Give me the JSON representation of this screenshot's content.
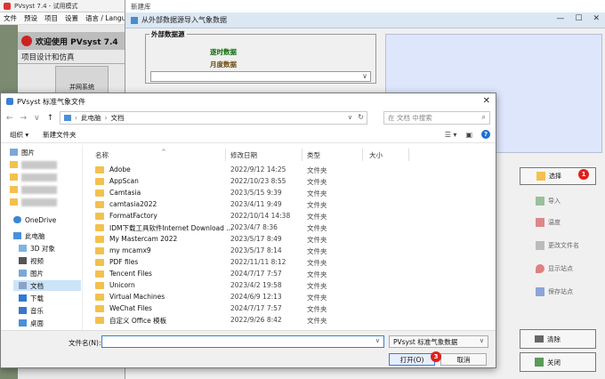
{
  "pvsyst": {
    "title": "PVsyst 7.4 - 试用模式",
    "menu": [
      "文件",
      "预设",
      "项目",
      "设置",
      "语言 / Langu"
    ],
    "welcome": "欢迎使用 PVsyst 7.4",
    "section": "项目设计和仿真",
    "tile": "并网系统"
  },
  "import_dialog": {
    "parent_title": "新建库",
    "title": "从外部数据源导入气象数据",
    "group_label": "外部数据源",
    "realtime": "逐时数据",
    "monthly": "月度数据",
    "buttons": [
      {
        "label": "选择",
        "icon": "folder-open-icon",
        "active": true
      },
      {
        "label": "导入",
        "icon": "import-icon",
        "active": false
      },
      {
        "label": "温度",
        "icon": "thermometer-icon",
        "active": false
      },
      {
        "label": "更改文件名",
        "icon": "rename-icon",
        "active": false
      },
      {
        "label": "显示站点",
        "icon": "location-pin-icon",
        "active": false
      },
      {
        "label": "保存站点",
        "icon": "save-icon",
        "active": false
      }
    ],
    "clear_label": "清除",
    "close_label": "关闭"
  },
  "badges": [
    "1",
    "2",
    "3"
  ],
  "file_dialog": {
    "title": "PVsyst 标准气象文件",
    "breadcrumb": [
      "此电脑",
      "文档"
    ],
    "search_placeholder": "在 文档 中搜索",
    "organize": "组织 ▾",
    "new_folder": "新建文件夹",
    "tree": [
      {
        "label": "图片",
        "icon": "pictures-icon",
        "blurred": false
      },
      {
        "label": "",
        "icon": "folder-icon",
        "blurred": true
      },
      {
        "label": "",
        "icon": "folder-icon",
        "blurred": true
      },
      {
        "label": "",
        "icon": "folder-icon",
        "blurred": true
      },
      {
        "label": "",
        "icon": "folder-icon",
        "blurred": true
      },
      {
        "label": "OneDrive",
        "icon": "cloud-icon",
        "blurred": false
      },
      {
        "label": "此电脑",
        "icon": "pc-icon",
        "blurred": false
      },
      {
        "label": "3D 对象",
        "icon": "cube-icon",
        "blurred": false
      },
      {
        "label": "视频",
        "icon": "video-icon",
        "blurred": false
      },
      {
        "label": "图片",
        "icon": "pictures-icon",
        "blurred": false
      },
      {
        "label": "文档",
        "icon": "documents-icon",
        "blurred": false,
        "selected": true
      },
      {
        "label": "下载",
        "icon": "download-icon",
        "blurred": false
      },
      {
        "label": "音乐",
        "icon": "music-icon",
        "blurred": false
      },
      {
        "label": "桌面",
        "icon": "desktop-icon",
        "blurred": false
      }
    ],
    "columns": [
      "名称",
      "修改日期",
      "类型",
      "大小"
    ],
    "rows": [
      {
        "name": "Adobe",
        "date": "2022/9/12 14:25",
        "type": "文件夹"
      },
      {
        "name": "AppScan",
        "date": "2022/10/23 8:55",
        "type": "文件夹"
      },
      {
        "name": "Camtasia",
        "date": "2023/5/15 9:39",
        "type": "文件夹"
      },
      {
        "name": "camtasia2022",
        "date": "2023/4/11 9:49",
        "type": "文件夹"
      },
      {
        "name": "FormatFactory",
        "date": "2022/10/14 14:38",
        "type": "文件夹"
      },
      {
        "name": "IDM下载工具软件Internet Download ...",
        "date": "2023/4/7 8:36",
        "type": "文件夹"
      },
      {
        "name": "My Mastercam 2022",
        "date": "2023/5/17 8:49",
        "type": "文件夹"
      },
      {
        "name": "my mcamx9",
        "date": "2023/5/17 8:14",
        "type": "文件夹"
      },
      {
        "name": "PDF files",
        "date": "2022/11/11 8:12",
        "type": "文件夹"
      },
      {
        "name": "Tencent Files",
        "date": "2024/7/17 7:57",
        "type": "文件夹"
      },
      {
        "name": "Unicorn",
        "date": "2023/4/2 19:58",
        "type": "文件夹"
      },
      {
        "name": "Virtual Machines",
        "date": "2024/6/9 12:13",
        "type": "文件夹"
      },
      {
        "name": "WeChat Files",
        "date": "2024/7/17 7:57",
        "type": "文件夹"
      },
      {
        "name": "自定义 Office 模板",
        "date": "2022/9/26 8:42",
        "type": "文件夹"
      }
    ],
    "filename_label": "文件名(N):",
    "filename_value": "",
    "filetype_value": "PVsyst 标准气象数据",
    "open_label": "打开(O)",
    "cancel_label": "取消"
  }
}
